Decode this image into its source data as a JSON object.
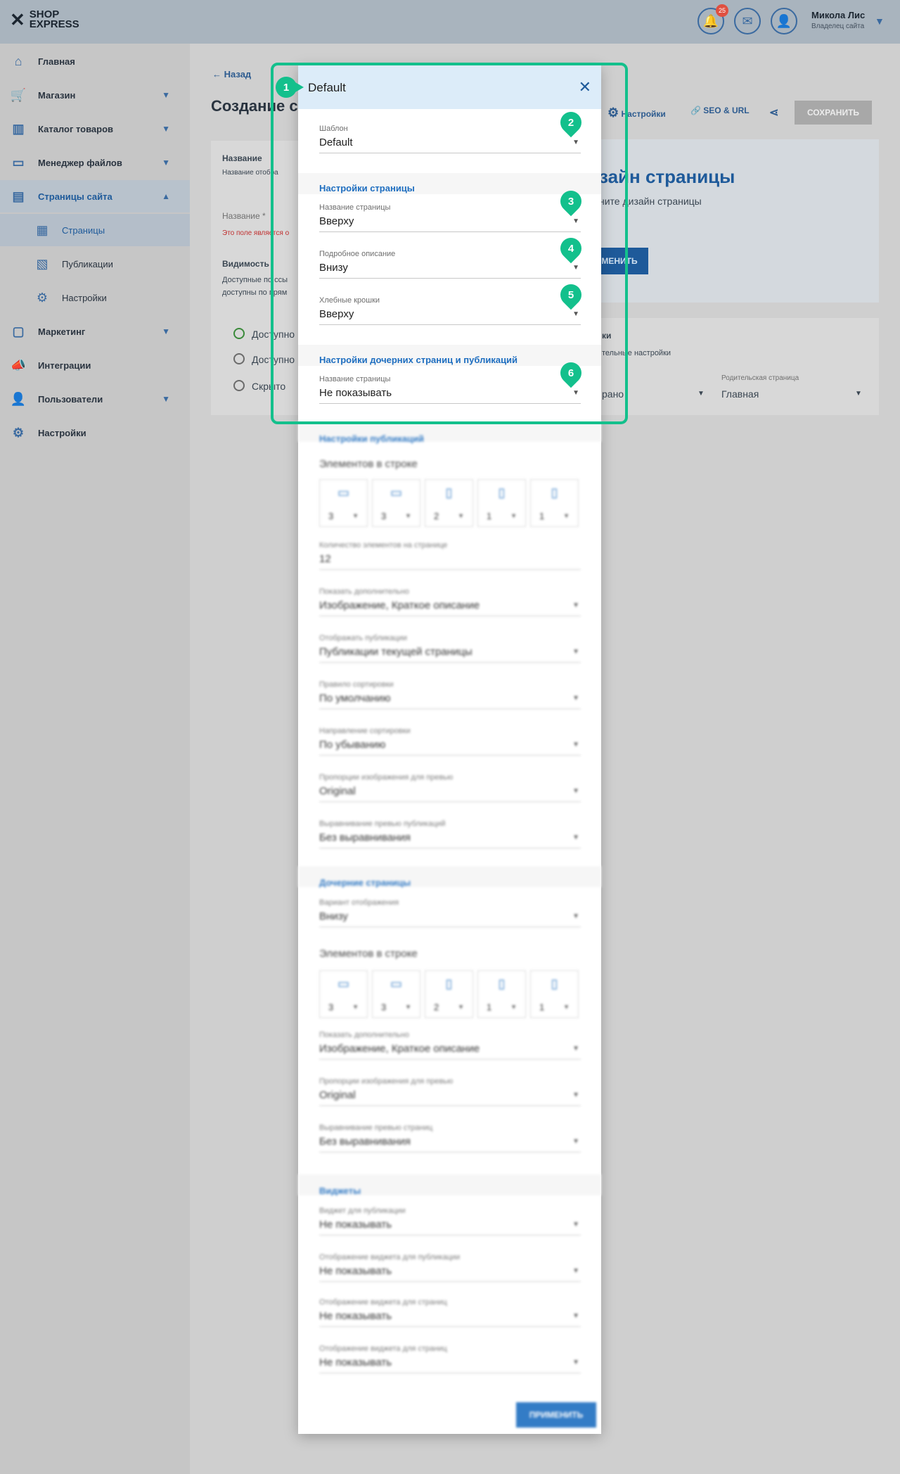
{
  "header": {
    "logo_text": "SHOP EXPRESS",
    "notif_count": "25",
    "user_name": "Микола Лис",
    "user_role": "Владелец сайта"
  },
  "sidebar": {
    "items": [
      {
        "label": "Главная",
        "icon": "home-icon"
      },
      {
        "label": "Магазин",
        "icon": "cart-icon"
      },
      {
        "label": "Каталог товаров",
        "icon": "book-icon"
      },
      {
        "label": "Менеджер файлов",
        "icon": "folder-icon"
      },
      {
        "label": "Страницы сайта",
        "icon": "pages-icon"
      },
      {
        "label": "Страницы",
        "icon": "page-icon"
      },
      {
        "label": "Публикации",
        "icon": "publications-icon"
      },
      {
        "label": "Настройки",
        "icon": "gear-icon"
      },
      {
        "label": "Маркетинг",
        "icon": "marketing-icon"
      },
      {
        "label": "Интеграции",
        "icon": "megaphone-icon"
      },
      {
        "label": "Пользователи",
        "icon": "user-icon"
      },
      {
        "label": "Настройки",
        "icon": "gear-icon"
      }
    ]
  },
  "background": {
    "back_label": "Назад",
    "page_title": "Создание с",
    "settings_link": "Настройки",
    "seo_link": "SEO & URL",
    "save_label": "СОХРАНИТЬ",
    "name_heading": "Название",
    "name_desc": "Название отобра",
    "name_field_label": "Название *",
    "name_error": "Это поле является о",
    "visibility_heading": "Видимость",
    "visibility_desc_1": "Доступные по ссы",
    "visibility_desc_2": "доступны по прям",
    "radio_1": "Доступно",
    "radio_2": "Доступно",
    "radio_3": "Скрыто",
    "banner_title": "зайн страницы",
    "banner_sub": "ните дизайн страницы",
    "banner_button": "МЕНИТЬ",
    "extra_heading": "ки",
    "extra_desc": "тельные настройки",
    "extra_value": "рано",
    "parent_label": "Родительская страница",
    "parent_value": "Главная"
  },
  "dialog": {
    "title": "Default",
    "template": {
      "label": "Шаблон",
      "value": "Default"
    },
    "page_settings": {
      "title": "Настройки страницы",
      "fields": [
        {
          "label": "Название страницы",
          "value": "Вверху"
        },
        {
          "label": "Подробное описание",
          "value": "Внизу"
        },
        {
          "label": "Хлебные крошки",
          "value": "Вверху"
        }
      ]
    },
    "child_settings": {
      "title": "Настройки дочерних страниц и публикаций",
      "fields": [
        {
          "label": "Название страницы",
          "value": "Не показывать"
        }
      ]
    },
    "publication_settings": {
      "title": "Настройки публикаций",
      "per_row_label": "Элементов в строке",
      "devices": [
        {
          "icon": "desktop-icon",
          "value": "3"
        },
        {
          "icon": "laptop-icon",
          "value": "3"
        },
        {
          "icon": "tablet-icon",
          "value": "2"
        },
        {
          "icon": "phone-icon",
          "value": "1"
        },
        {
          "icon": "phone-small-icon",
          "value": "1"
        }
      ],
      "count": {
        "label": "Количество элементов на странице",
        "value": "12"
      },
      "fields": [
        {
          "label": "Показать дополнительно",
          "value": "Изображение, Краткое описание"
        },
        {
          "label": "Отображать публикации",
          "value": "Публикации текущей страницы"
        },
        {
          "label": "Правило сортировки",
          "value": "По умолчанию"
        },
        {
          "label": "Направление сортировки",
          "value": "По убыванию"
        },
        {
          "label": "Пропорции изображения для превью",
          "value": "Original"
        },
        {
          "label": "Выравнивание превью публикаций",
          "value": "Без выравнивания"
        }
      ]
    },
    "child_pages": {
      "title": "Дочерние страницы",
      "display_variant": {
        "label": "Вариант отображения",
        "value": "Внизу"
      },
      "per_row_label": "Элементов в строке",
      "devices": [
        {
          "icon": "desktop-icon",
          "value": "3"
        },
        {
          "icon": "laptop-icon",
          "value": "3"
        },
        {
          "icon": "tablet-icon",
          "value": "2"
        },
        {
          "icon": "phone-icon",
          "value": "1"
        },
        {
          "icon": "phone-small-icon",
          "value": "1"
        }
      ],
      "fields": [
        {
          "label": "Показать дополнительно",
          "value": "Изображение, Краткое описание"
        },
        {
          "label": "Пропорции изображения для превью",
          "value": "Original"
        },
        {
          "label": "Выравнивание превью страниц",
          "value": "Без выравнивания"
        }
      ]
    },
    "widgets": {
      "title": "Виджеты",
      "fields": [
        {
          "label": "Виджет для публикации",
          "value": "Не показывать"
        },
        {
          "label": "Отображение виджета для публикации",
          "value": "Не показывать"
        },
        {
          "label": "Отображение виджета для страниц",
          "value": "Не показывать"
        },
        {
          "label": "Отображение виджета для страниц",
          "value": "Не показывать"
        }
      ]
    },
    "apply_label": "ПРИМЕНИТЬ"
  },
  "markers": [
    "1",
    "2",
    "3",
    "4",
    "5",
    "6"
  ],
  "colors": {
    "accent": "#1e6ec0",
    "highlight": "#13c08c",
    "dialog_header": "#dcecf9"
  }
}
